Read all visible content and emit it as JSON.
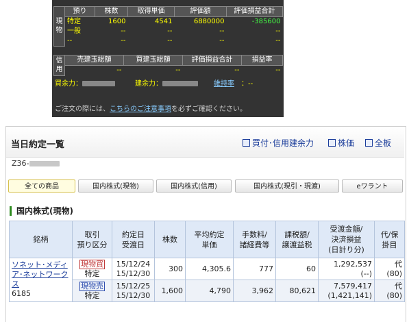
{
  "holdings": {
    "side_label": "現物",
    "headers": [
      "預り",
      "株数",
      "取得単価",
      "評価額",
      "評価損益合計"
    ],
    "rows": [
      {
        "type": "特定",
        "shares": "1600",
        "price": "4541",
        "value": "6880000",
        "pl": "-385600"
      },
      {
        "type": "一般",
        "shares": "--",
        "price": "--",
        "value": "--",
        "pl": "--"
      },
      {
        "type": "--",
        "shares": "--",
        "price": "--",
        "value": "--",
        "pl": "--"
      }
    ]
  },
  "margin": {
    "side_label": "信用",
    "headers": [
      "売建玉総額",
      "買建玉総額",
      "評価損益合計",
      "損益率"
    ],
    "row": [
      "--",
      "--",
      "--",
      "--"
    ]
  },
  "power": {
    "buying_label": "買余力：",
    "building_label": "建余力：",
    "maintenance_link": "維持率",
    "maintenance_value": "：--"
  },
  "notice": {
    "prefix": "ご注文の際には、",
    "link": "こちらのご注意事項",
    "suffix": "を必ずご確認ください。"
  },
  "panel": {
    "title": "当日約定一覧",
    "links": [
      "買付･信用建余力",
      "株価",
      "全板"
    ],
    "account": "Z36-",
    "tabs": [
      "全ての商品",
      "国内株式(現物)",
      "国内株式(信用)",
      "国内株式(現引・現渡)",
      "eワラント"
    ],
    "section": "国内株式(現物)"
  },
  "table": {
    "headers": [
      "銘柄",
      "取引\n預り区分",
      "約定日\n受渡日",
      "株数",
      "平均約定\n単価",
      "手数料/\n諸経費等",
      "課税額/\n譲渡益税",
      "受渡金額/\n決済損益\n(日計り分)",
      "代/保\n掛目"
    ],
    "stock": {
      "name": "ソネット･メディア･ネットワークス",
      "code": "6185"
    },
    "rows": [
      {
        "side": "現物買",
        "account": "特定",
        "trade_date": "15/12/24",
        "settle_date": "15/12/30",
        "shares": "300",
        "avg_price": "4,305.6",
        "fee": "777",
        "tax": "60",
        "amount": "1,292,537",
        "pl": "(--)",
        "margin": "代",
        "ratio": "(80)"
      },
      {
        "side": "現物売",
        "account": "特定",
        "trade_date": "15/12/25",
        "settle_date": "15/12/30",
        "shares": "1,600",
        "avg_price": "4,790",
        "fee": "3,962",
        "tax": "80,621",
        "amount": "7,579,417",
        "pl": "(1,421,141)",
        "margin": "代",
        "ratio": "(80)"
      }
    ]
  }
}
